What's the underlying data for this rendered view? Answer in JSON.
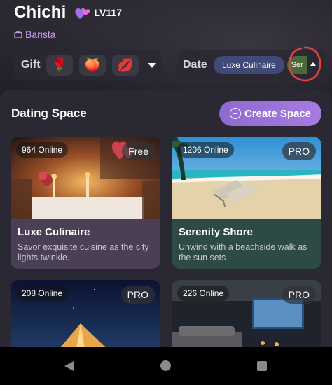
{
  "profile": {
    "name": "Chichi",
    "level": "LV117",
    "role": "Barista"
  },
  "gift": {
    "label": "Gift",
    "items": [
      {
        "icon": "rose-icon",
        "glyph": "🌹"
      },
      {
        "icon": "peach-icon",
        "glyph": "🍑"
      },
      {
        "icon": "lips-icon",
        "glyph": "💋"
      }
    ]
  },
  "date": {
    "label": "Date",
    "selected": "Luxe Culinaire",
    "next": "Ser"
  },
  "dating_space": {
    "title": "Dating Space",
    "create_label": "Create Space",
    "cards": [
      {
        "online": "964 Online",
        "tier": "Free",
        "title": "Luxe Culinaire",
        "desc": "Savor exquisite cuisine as the city lights twinkle."
      },
      {
        "online": "1206 Online",
        "tier": "PRO",
        "title": "Serenity Shore",
        "desc": "Unwind with a beachside walk as the sun sets"
      },
      {
        "online": "208 Online",
        "tier": "PRO",
        "title": "",
        "desc": ""
      },
      {
        "online": "226 Online",
        "tier": "PRO",
        "title": "",
        "desc": ""
      }
    ]
  },
  "colors": {
    "accent_purple": "#a77be0",
    "role_purple": "#c79ef2",
    "date_chip": "#3f4a78",
    "annotation_red": "#e8413f"
  }
}
